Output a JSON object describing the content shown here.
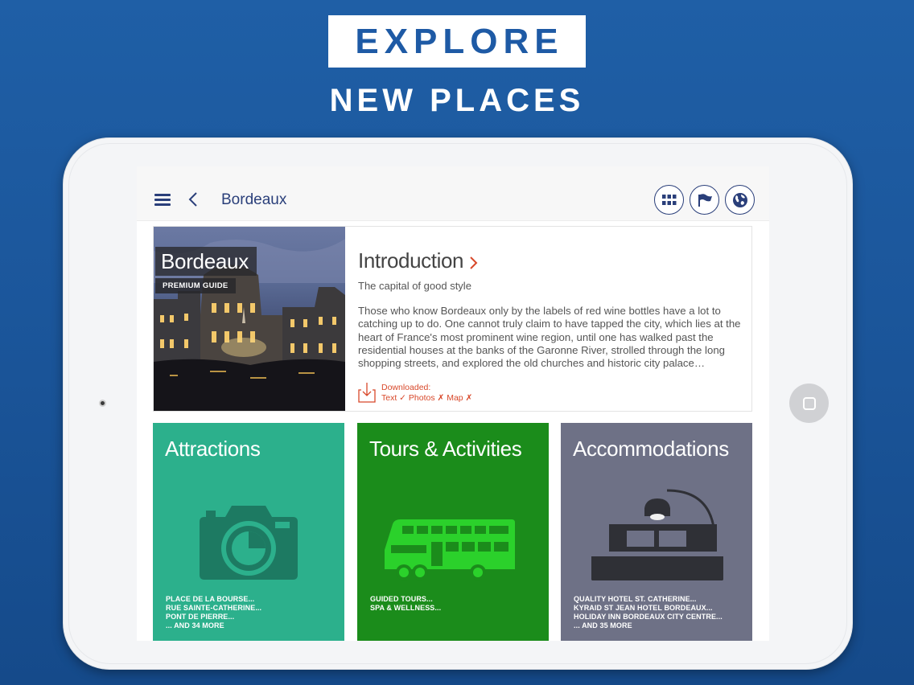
{
  "promo": {
    "headline": "EXPLORE",
    "subheadline": "NEW PLACES"
  },
  "colors": {
    "background_blue": "#1b569b",
    "nav_ink": "#2a3f7a",
    "accent_orange": "#d8482a",
    "attractions": "#2cb08c",
    "tours": "#1b8c1b",
    "accommodations": "#6e7186"
  },
  "topbar": {
    "title": "Bordeaux",
    "icons": [
      "menu-icon",
      "back-icon",
      "grid-icon",
      "flag-icon",
      "globe-icon"
    ]
  },
  "intro": {
    "hero_label": "Bordeaux",
    "hero_badge": "PREMIUM GUIDE",
    "title": "Introduction",
    "subtitle": "The capital of good style",
    "body": "Those who know Bordeaux only by the labels of red wine bottles have a lot to catching up to do. One cannot truly claim to have tapped the city, which lies at the heart of France's most prominent wine region, until one has walked past the residential houses at the banks of the Garonne River, strolled through the long shopping streets, and explored the old churches and historic city palace…",
    "download_label": "Downloaded:",
    "download_status": "Text ✓ Photos ✗ Map ✗"
  },
  "tiles": [
    {
      "title": "Attractions",
      "icon": "camera-icon",
      "items": [
        "PLACE DE LA BOURSE...",
        "RUE SAINTE-CATHERINE...",
        "PONT DE PIERRE...",
        "... AND 34 MORE"
      ]
    },
    {
      "title": "Tours & Activities",
      "icon": "bus-icon",
      "items": [
        "GUIDED TOURS...",
        "SPA & WELLNESS..."
      ]
    },
    {
      "title": "Accommodations",
      "icon": "bed-icon",
      "items": [
        "QUALITY HOTEL ST. CATHERINE...",
        "KYRAID ST JEAN HOTEL BORDEAUX...",
        "HOLIDAY INN BORDEAUX CITY CENTRE...",
        "... AND 35 MORE"
      ]
    }
  ]
}
